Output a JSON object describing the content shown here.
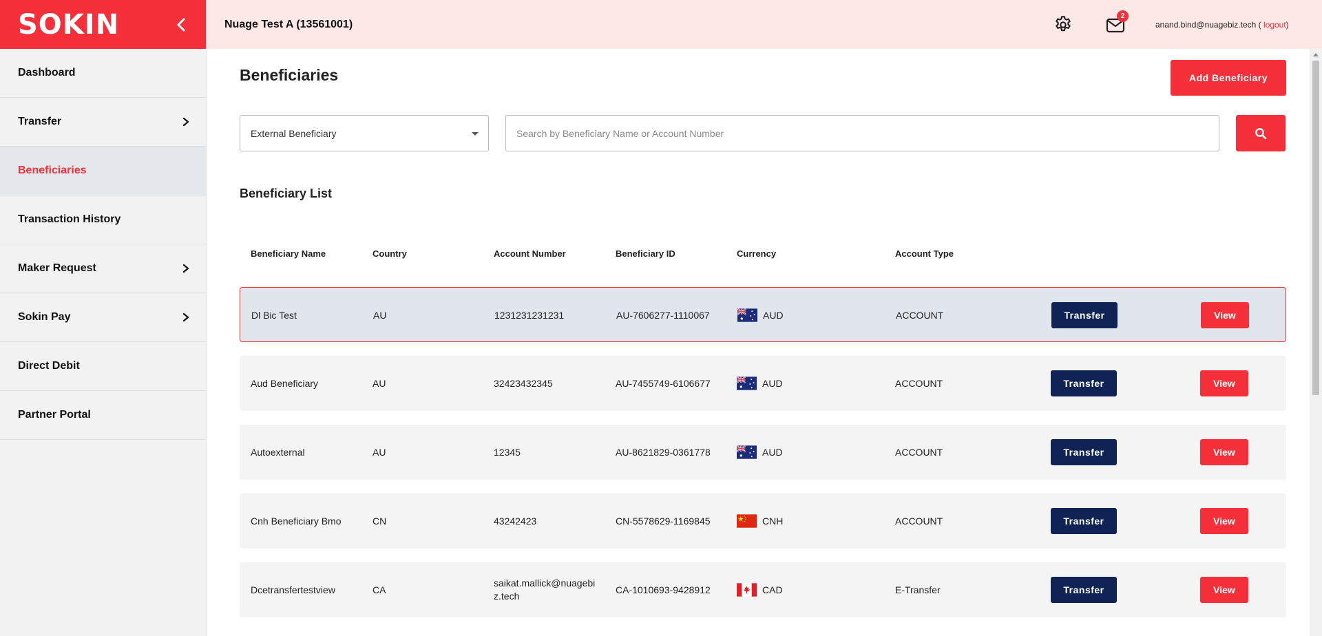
{
  "brand": {
    "logo_text": "SOKIN",
    "color": "#f5303a"
  },
  "sidebar": {
    "items": [
      {
        "label": "Dashboard",
        "has_children": false,
        "active": false
      },
      {
        "label": "Transfer",
        "has_children": true,
        "active": false
      },
      {
        "label": "Beneficiaries",
        "has_children": false,
        "active": true
      },
      {
        "label": "Transaction History",
        "has_children": false,
        "active": false
      },
      {
        "label": "Maker Request",
        "has_children": true,
        "active": false
      },
      {
        "label": "Sokin Pay",
        "has_children": true,
        "active": false
      },
      {
        "label": "Direct Debit",
        "has_children": false,
        "active": false
      },
      {
        "label": "Partner Portal",
        "has_children": false,
        "active": false
      }
    ]
  },
  "header": {
    "org_name": "Nuage Test A (13561001)",
    "notification_count": "2",
    "user_email": "anand.bind@nuagebiz.tech",
    "paren_open": "(",
    "logout_label": "logout",
    "paren_close": ")"
  },
  "page": {
    "title": "Beneficiaries",
    "add_button_label": "Add Beneficiary",
    "filter_select_value": "External Beneficiary",
    "search_placeholder": "Search by Beneficiary Name or Account Number",
    "list_title": "Beneficiary List"
  },
  "table": {
    "columns": [
      "Beneficiary Name",
      "Country",
      "Account Number",
      "Beneficiary ID",
      "Currency",
      "Account Type"
    ],
    "transfer_label": "Transfer",
    "view_label": "View",
    "rows": [
      {
        "name": "Dl Bic Test",
        "country": "AU",
        "account_number": "1231231231231",
        "beneficiary_id": "AU-7606277-1110067",
        "currency": "AUD",
        "flag": "australia-flag-icon",
        "account_type": "ACCOUNT",
        "selected": true
      },
      {
        "name": "Aud Beneficiary",
        "country": "AU",
        "account_number": "32423432345",
        "beneficiary_id": "AU-7455749-6106677",
        "currency": "AUD",
        "flag": "australia-flag-icon",
        "account_type": "ACCOUNT",
        "selected": false
      },
      {
        "name": "Autoexternal",
        "country": "AU",
        "account_number": "12345",
        "beneficiary_id": "AU-8621829-0361778",
        "currency": "AUD",
        "flag": "australia-flag-icon",
        "account_type": "ACCOUNT",
        "selected": false
      },
      {
        "name": "Cnh Beneficiary Bmo",
        "country": "CN",
        "account_number": "43242423",
        "beneficiary_id": "CN-5578629-1169845",
        "currency": "CNH",
        "flag": "china-flag-icon",
        "account_type": "ACCOUNT",
        "selected": false
      },
      {
        "name": "Dcetransfertestview",
        "country": "CA",
        "account_number": "saikat.mallick@nuagebiz.tech",
        "beneficiary_id": "CA-1010693-9428912",
        "currency": "CAD",
        "flag": "canada-flag-icon",
        "account_type": "E-Transfer",
        "selected": false
      }
    ]
  },
  "colors": {
    "accent": "#f5303a",
    "navy": "#0f2355",
    "header_bg": "#fde8e8"
  }
}
